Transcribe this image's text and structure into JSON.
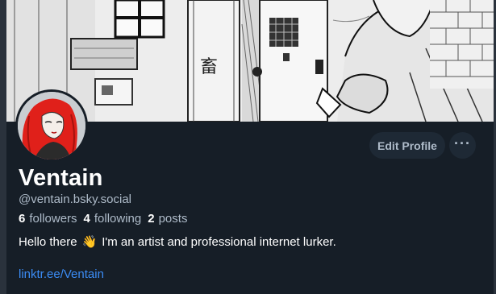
{
  "profile": {
    "display_name": "Ventain",
    "handle": "@ventain.bsky.social",
    "bio_before": "Hello there",
    "bio_emoji": "👋",
    "bio_after": "I'm an artist and professional internet lurker.",
    "link_text": "linktr.ee/Ventain"
  },
  "stats": {
    "followers_count": "6",
    "followers_label": "followers",
    "following_count": "4",
    "following_label": "following",
    "posts_count": "2",
    "posts_label": "posts"
  },
  "actions": {
    "edit_profile_label": "Edit Profile",
    "more_label": "···"
  },
  "icons": {
    "more": "more-horizontal-icon"
  },
  "colors": {
    "background": "#161e27",
    "button_bg": "#1e2935",
    "muted_text": "#aebbc9",
    "link": "#3b8cf5",
    "avatar_hair": "#e0201a"
  }
}
